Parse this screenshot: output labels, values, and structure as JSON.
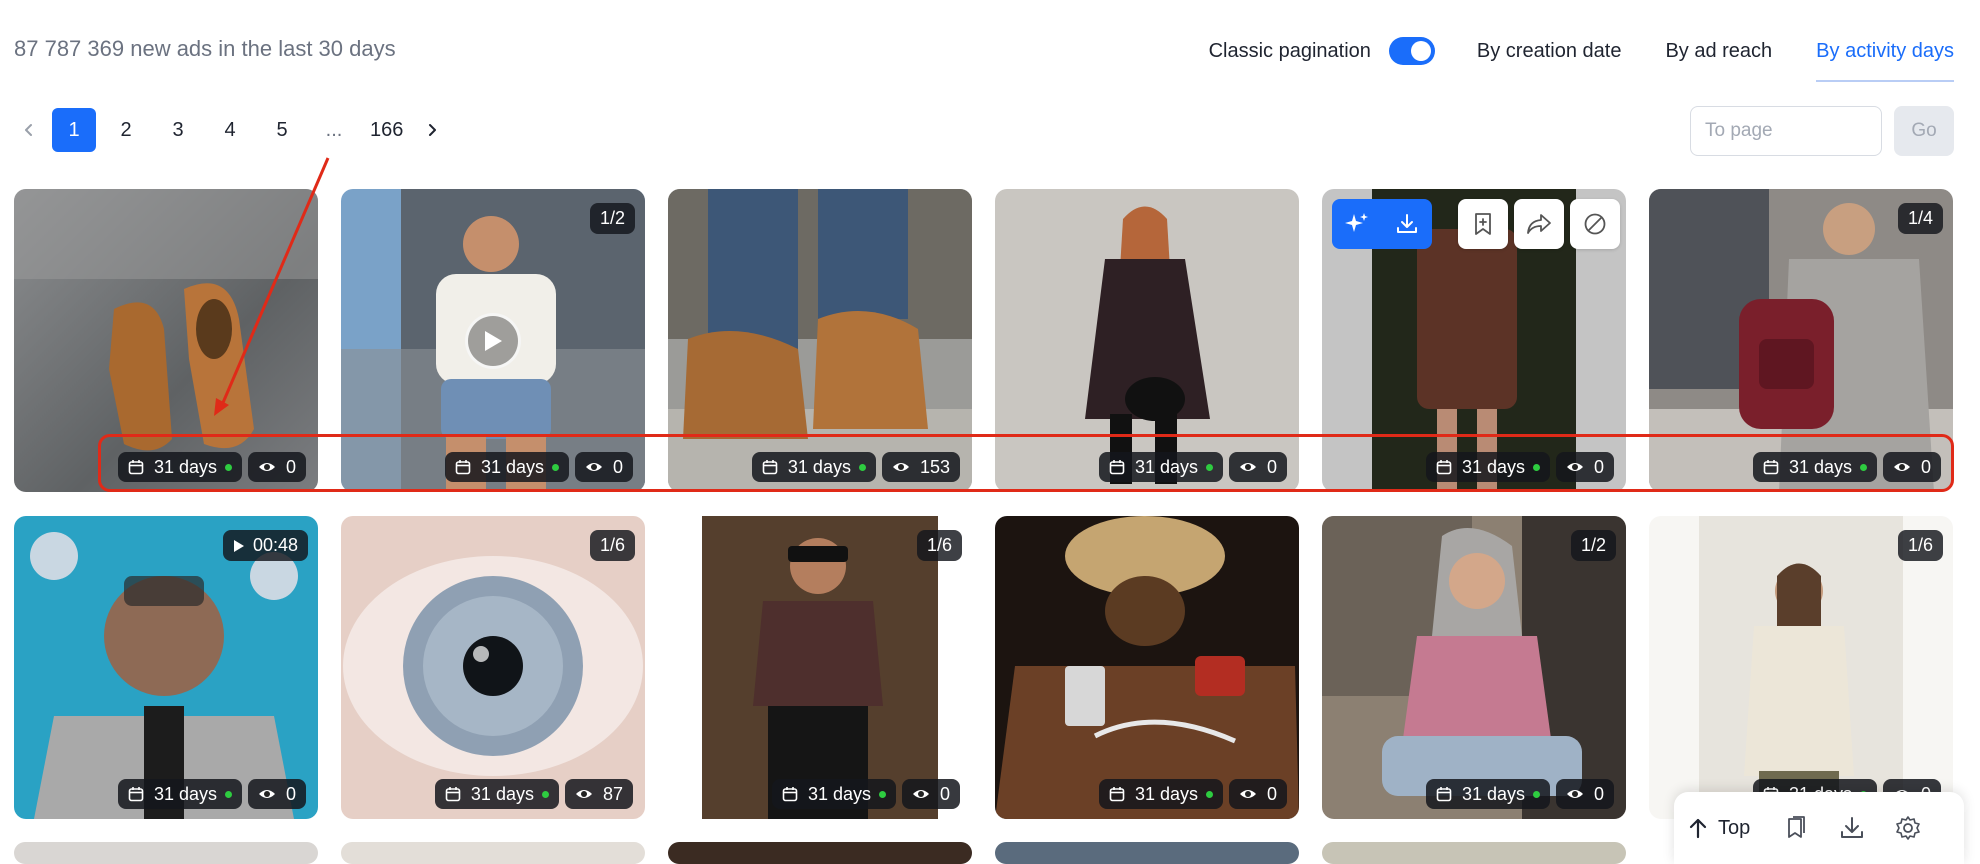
{
  "header": {
    "stats_text": "87 787 369 new ads in the last 30 days",
    "classic_pagination_label": "Classic pagination",
    "classic_pagination_on": true,
    "sort_options": [
      "By creation date",
      "By ad reach",
      "By activity days"
    ],
    "active_sort": "By activity days"
  },
  "pagination": {
    "pages": [
      "1",
      "2",
      "3",
      "4",
      "5",
      "...",
      "166"
    ],
    "current": "1",
    "goto_placeholder": "To page",
    "go_label": "Go"
  },
  "colors": {
    "accent": "#1a6dfa",
    "annotation_red": "#e02a18",
    "active_dot": "#2ecc40"
  },
  "cards": [
    {
      "subject": "brown leather shoes on concrete",
      "badge": "",
      "video": false,
      "days": "31 days",
      "views": "0"
    },
    {
      "subject": "woman in denim shorts against wall",
      "badge": "1/2",
      "video": true,
      "days": "31 days",
      "views": "0"
    },
    {
      "subject": "brown suede boots walking",
      "badge": "",
      "video": false,
      "days": "31 days",
      "views": "153"
    },
    {
      "subject": "woman in floral dress",
      "badge": "",
      "video": false,
      "days": "31 days",
      "views": "0"
    },
    {
      "subject": "woman in tweed dress",
      "badge": "",
      "video": false,
      "days": "31 days",
      "views": "0",
      "hover_actions": true
    },
    {
      "subject": "woman with burgundy backpack",
      "badge": "1/4",
      "video": false,
      "days": "31 days",
      "views": "0"
    },
    {
      "subject": "man with glasses and lanyard",
      "badge": "00:48",
      "badge_is_duration": true,
      "video": false,
      "days": "31 days",
      "views": "0"
    },
    {
      "subject": "close-up of human eye",
      "badge": "1/6",
      "video": false,
      "days": "31 days",
      "views": "87"
    },
    {
      "subject": "man in brown shirt",
      "badge": "1/6",
      "video": false,
      "days": "31 days",
      "views": "0"
    },
    {
      "subject": "bedside table with medical supplies",
      "badge": "",
      "video": false,
      "days": "31 days",
      "views": "0"
    },
    {
      "subject": "woman in pink sweater",
      "badge": "1/2",
      "video": false,
      "days": "31 days",
      "views": "0"
    },
    {
      "subject": "woman in cream blouse",
      "badge": "1/6",
      "video": false,
      "days": "31 days",
      "views": "0"
    }
  ],
  "card5_actions": {
    "blue": [
      "sparkle-icon",
      "download-icon"
    ],
    "white": [
      "bookmark-add-icon",
      "share-icon",
      "block-icon"
    ]
  },
  "float_bar": {
    "top_label": "Top",
    "icons": [
      "copy-icon",
      "download-icon",
      "gear-icon"
    ]
  }
}
